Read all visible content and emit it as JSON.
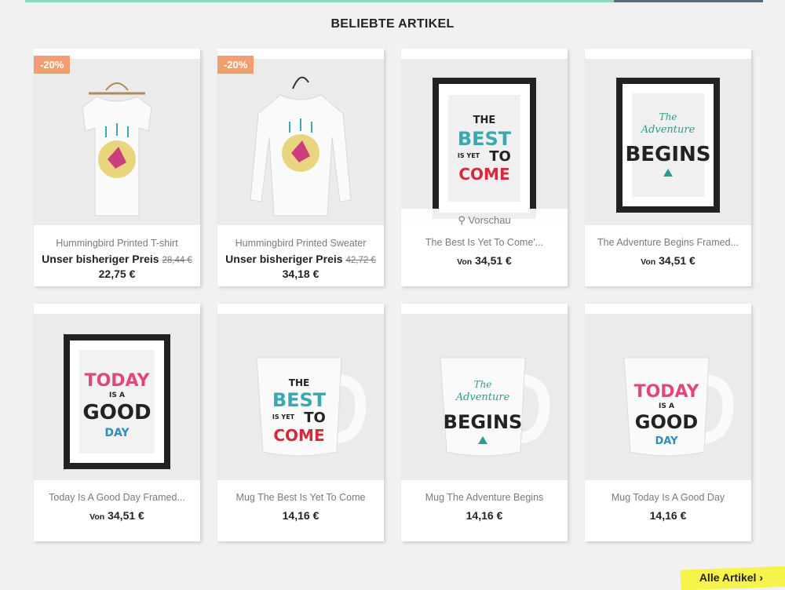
{
  "section": {
    "title": "BELIEBTE ARTIKEL"
  },
  "products": [
    {
      "name": "Hummingbird Printed T-shirt",
      "badge": "-20%",
      "price_label": "Unser bisheriger Preis",
      "regular_price": "28,44 €",
      "price": "22,75 €"
    },
    {
      "name": "Hummingbird Printed Sweater",
      "badge": "-20%",
      "price_label": "Unser bisheriger Preis",
      "regular_price": "42,72 €",
      "price": "34,18 €"
    },
    {
      "name": "The Best Is Yet To Come'...",
      "from": "Von",
      "price": "34,51 €",
      "quickview": "Vorschau"
    },
    {
      "name": "The Adventure Begins Framed...",
      "from": "Von",
      "price": "34,51 €"
    },
    {
      "name": "Today Is A Good Day Framed...",
      "from": "Von",
      "price": "34,51 €"
    },
    {
      "name": "Mug The Best Is Yet To Come",
      "price": "14,16 €"
    },
    {
      "name": "Mug The Adventure Begins",
      "price": "14,16 €"
    },
    {
      "name": "Mug Today Is A Good Day",
      "price": "14,16 €"
    }
  ],
  "artwork": {
    "best": [
      "THE",
      "BEST",
      "IS YET",
      "TO",
      "COME"
    ],
    "adventure": [
      "The",
      "Adventure",
      "BEGINS"
    ],
    "today": [
      "TODAY",
      "IS A",
      "GOOD",
      "DAY"
    ]
  },
  "footer": {
    "all_products": "Alle Artikel"
  },
  "colors": {
    "badge": "#f39d72",
    "highlight": "#f6f44a",
    "teal": "#2e9c8c",
    "red": "#d8283c",
    "pink": "#e04878",
    "blue": "#2b8fb8"
  }
}
